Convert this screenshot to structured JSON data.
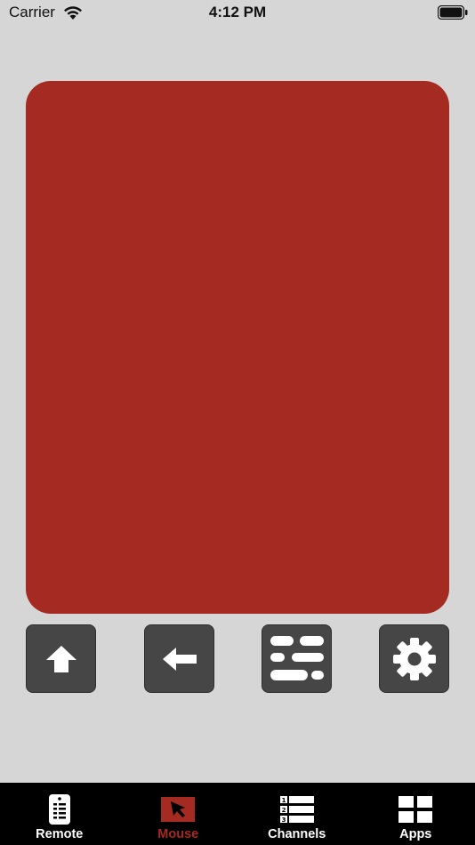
{
  "status_bar": {
    "carrier": "Carrier",
    "time": "4:12 PM",
    "icons": [
      "wifi-icon",
      "battery-icon"
    ]
  },
  "touchpad": {
    "color": "#a52a22"
  },
  "controls": [
    {
      "name": "home",
      "icon": "up-arrow-icon"
    },
    {
      "name": "back",
      "icon": "left-arrow-icon"
    },
    {
      "name": "menu",
      "icon": "menu-options-icon"
    },
    {
      "name": "settings",
      "icon": "gear-icon"
    }
  ],
  "tabs": [
    {
      "label": "Remote",
      "icon": "remote-icon",
      "active": false
    },
    {
      "label": "Mouse",
      "icon": "mouse-pointer-icon",
      "active": true
    },
    {
      "label": "Channels",
      "icon": "numbered-list-icon",
      "active": false
    },
    {
      "label": "Apps",
      "icon": "grid-icon",
      "active": false
    }
  ],
  "colors": {
    "accent": "#a52a22",
    "background": "#d6d6d6",
    "button": "#464646",
    "tab_bar": "#000000"
  }
}
